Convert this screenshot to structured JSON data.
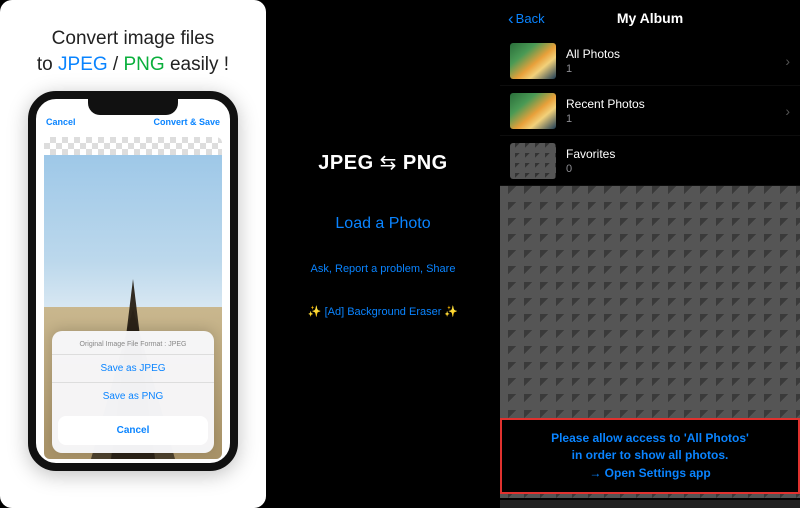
{
  "left": {
    "title_pre": "Convert image files\nto ",
    "title_jpeg": "JPEG",
    "title_sep": " / ",
    "title_png": "PNG",
    "title_post": " easily !",
    "topbar_cancel": "Cancel",
    "topbar_action": "Convert & Save",
    "sheet_hint": "Original Image File Format : JPEG",
    "sheet_opt1": "Save as JPEG",
    "sheet_opt2": "Save as PNG",
    "sheet_cancel": "Cancel"
  },
  "mid": {
    "logo_left": "JPEG",
    "logo_arrows": "⇆",
    "logo_right": "PNG",
    "load": "Load a Photo",
    "ask": "Ask, Report a problem, Share",
    "ad": "✨ [Ad] Background Eraser ✨"
  },
  "right": {
    "back": "Back",
    "title": "My Album",
    "albums": [
      {
        "name": "All Photos",
        "count": "1"
      },
      {
        "name": "Recent Photos",
        "count": "1"
      },
      {
        "name": "Favorites",
        "count": "0"
      }
    ],
    "banner_l1": "Please allow access to 'All Photos'",
    "banner_l2": "in order to show all photos.",
    "banner_l3": "→ Open Settings app"
  }
}
